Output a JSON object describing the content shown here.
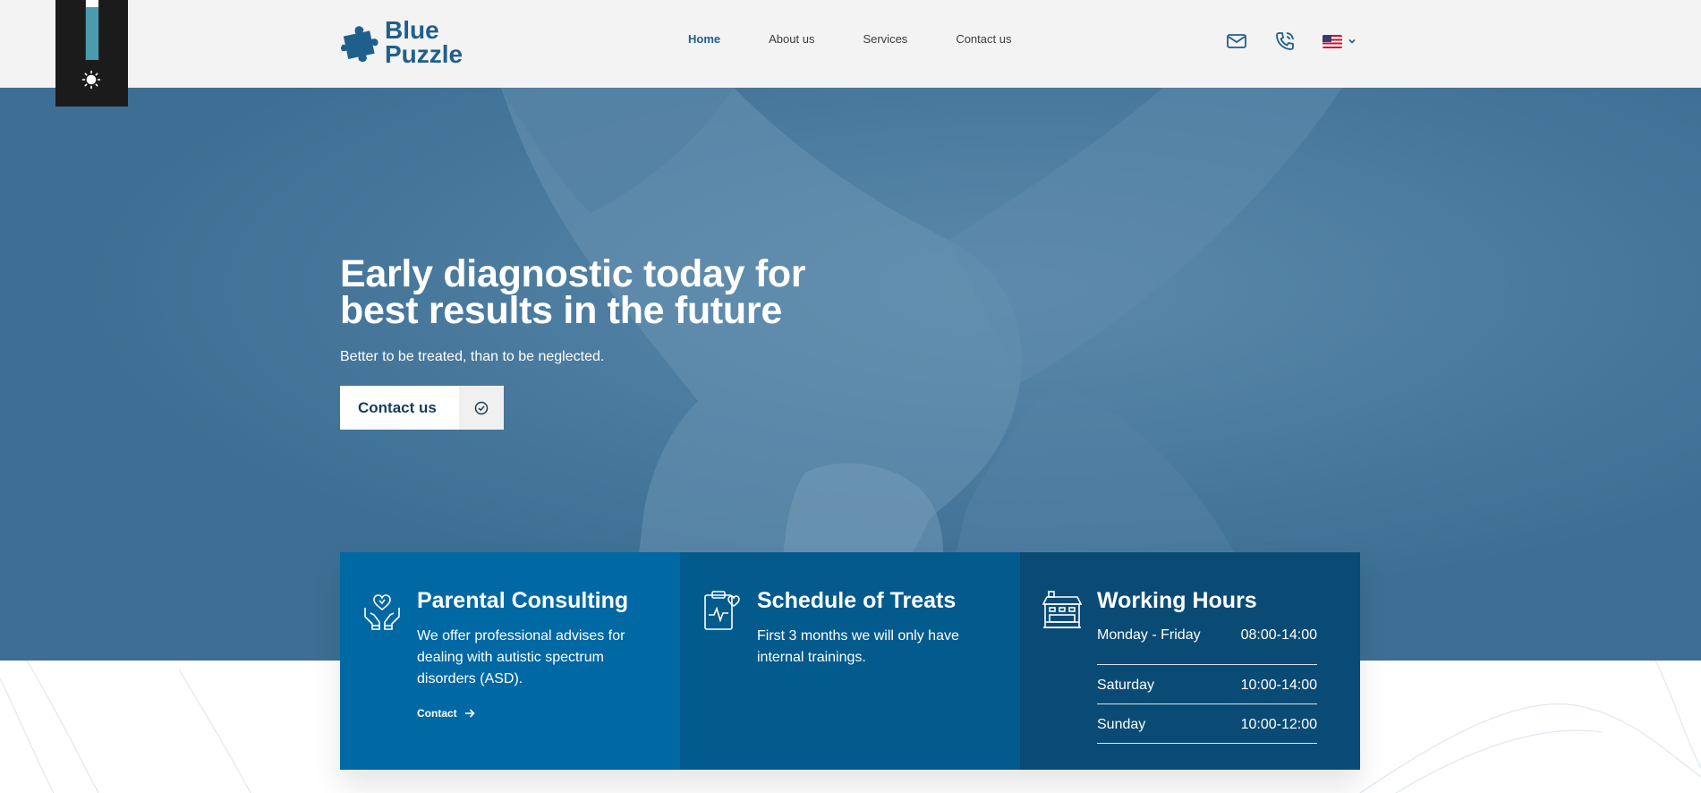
{
  "header": {
    "logo_line1": "Blue",
    "logo_line2": "Puzzle",
    "nav": [
      {
        "label": "Home",
        "active": true
      },
      {
        "label": "About us",
        "active": false
      },
      {
        "label": "Services",
        "active": false
      },
      {
        "label": "Contact us",
        "active": false
      }
    ],
    "icons": [
      "mail-icon",
      "phone-icon",
      "us-flag-icon",
      "chevron-down-icon"
    ]
  },
  "mode_toggle": {
    "icon": "sun-icon"
  },
  "hero": {
    "title": "Early diagnostic today for best results in the future",
    "subtitle": "Better to be treated, than to be neglected.",
    "cta_label": "Contact us",
    "cta_icon": "check-circle-icon"
  },
  "cards": {
    "parental": {
      "icon": "hands-heart-icon",
      "title": "Parental Consulting",
      "text": "We offer professional advises for dealing with autistic spectrum disorders (ASD).",
      "link": "Contact"
    },
    "schedule": {
      "icon": "clipboard-heart-icon",
      "title": "Schedule of Treats",
      "text": "First 3 months we will only have internal trainings."
    },
    "hours": {
      "icon": "building-icon",
      "title": "Working Hours",
      "rows": [
        {
          "day": "Monday - Friday",
          "time": "08:00-14:00"
        },
        {
          "day": "Saturday",
          "time": "10:00-14:00"
        },
        {
          "day": "Sunday",
          "time": "10:00-12:00"
        }
      ]
    }
  },
  "colors": {
    "brand": "#1f5f8b",
    "hero_bg": "#3d6f94",
    "card1": "#0068a3",
    "card2": "#035b8d",
    "card3": "#0a4b75"
  }
}
